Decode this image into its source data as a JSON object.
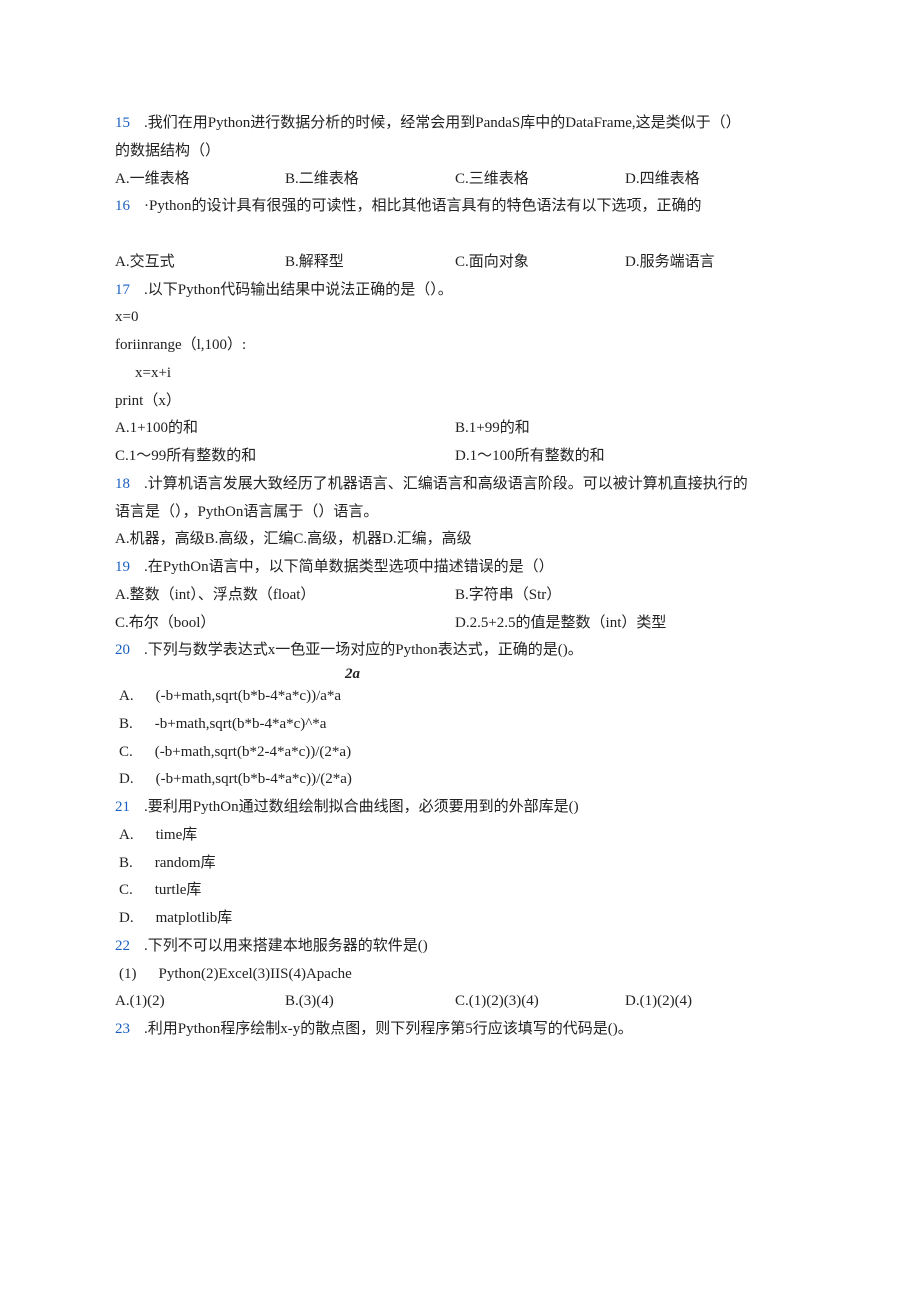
{
  "q15": {
    "num": "15",
    "stem1": ".我们在用Python进行数据分析的时候，经常会用到PandaS库中的DataFrame,这是类似于（）",
    "stem2": "的数据结构（）",
    "A": "A.一维表格",
    "B": "B.二维表格",
    "C": "C.三维表格",
    "D": "D.四维表格"
  },
  "q16": {
    "num": "16",
    "stem": "·Python的设计具有很强的可读性，相比其他语言具有的特色语法有以下选项，正确的",
    "A": "A.交互式",
    "B": "B.解释型",
    "C": "C.面向对象",
    "D": "D.服务端语言"
  },
  "q17": {
    "num": "17",
    "stem": ".以下Python代码输出结果中说法正确的是（）。",
    "code1": "x=0",
    "code2": "foriinrange（l,100）:",
    "code3": "x=x+i",
    "code4": "print（x）",
    "A": "A.1+100的和",
    "B": "B.1+99的和",
    "C": "C.1～99所有整数的和",
    "D": "D.1～100所有整数的和"
  },
  "q18": {
    "num": "18",
    "stem1": ".计算机语言发展大致经历了机器语言、汇编语言和高级语言阶段。可以被计算机直接执行的",
    "stem2": "语言是（），PythOn语言属于（）语言。",
    "opts": "A.机器，高级B.高级，汇编C.高级，机器D.汇编，高级"
  },
  "q19": {
    "num": "19",
    "stem": ".在PythOn语言中，以下简单数据类型选项中描述错误的是（）",
    "A": "A.整数（int）、浮点数（float）",
    "B": "B.字符串（Str）",
    "C": "C.布尔（bool）",
    "D": "D.2.5+2.5的值是整数（int）类型"
  },
  "q20": {
    "num": "20",
    "stem": ".下列与数学表达式x一色亚一场对应的Python表达式，正确的是()。",
    "formula": "2a",
    "A": "(-b+math,sqrt(b*b-4*a*c))/a*a",
    "B": "-b+math,sqrt(b*b-4*a*c)^*a",
    "C": "(-b+math,sqrt(b*2-4*a*c))/(2*a)",
    "D": "(-b+math,sqrt(b*b-4*a*c))/(2*a)"
  },
  "q21": {
    "num": "21",
    "stem": ".要利用PythOn通过数组绘制拟合曲线图，必须要用到的外部库是()",
    "A": "time库",
    "B": "random库",
    "C": "turtle库",
    "D": "matplotlib库"
  },
  "q22": {
    "num": "22",
    "stem": ".下列不可以用来搭建本地服务器的软件是()",
    "sub": "Python(2)Excel(3)IIS(4)Apache",
    "A": "A.(1)(2)",
    "B": "B.(3)(4)",
    "C": "C.(1)(2)(3)(4)",
    "D": "D.(1)(2)(4)"
  },
  "q23": {
    "num": "23",
    "stem": ".利用Python程序绘制x-y的散点图，则下列程序第5行应该填写的代码是()。"
  },
  "letters": {
    "A": "A.",
    "B": "B.",
    "C": "C.",
    "D": "D.",
    "one": "(1)"
  }
}
